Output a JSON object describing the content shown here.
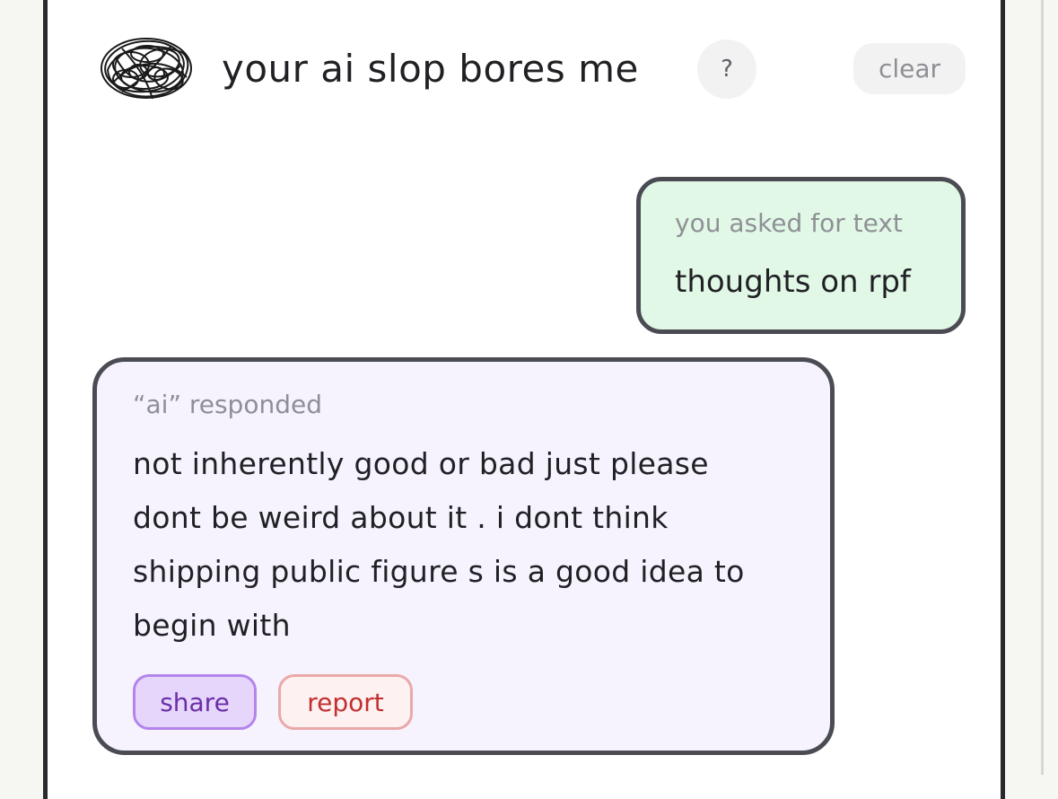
{
  "header": {
    "title": "your ai slop bores me",
    "help_label": "?",
    "clear_label": "clear",
    "logo_icon": "scribble-logo-icon"
  },
  "conversation": {
    "user_message": {
      "label": "you asked for text",
      "text": "thoughts on rpf"
    },
    "ai_message": {
      "label": "“ai” responded",
      "text": "not inherently good or bad just please dont be weird about it . i dont think shipping public figure s is a good idea to begin with",
      "share_label": "share",
      "report_label": "report"
    }
  },
  "colors": {
    "user_bubble_bg": "#e2f8e7",
    "ai_bubble_bg": "#f6f3fe",
    "bubble_border": "#4b4c53",
    "share_accent": "#b385ec",
    "report_accent": "#c22f2f"
  }
}
